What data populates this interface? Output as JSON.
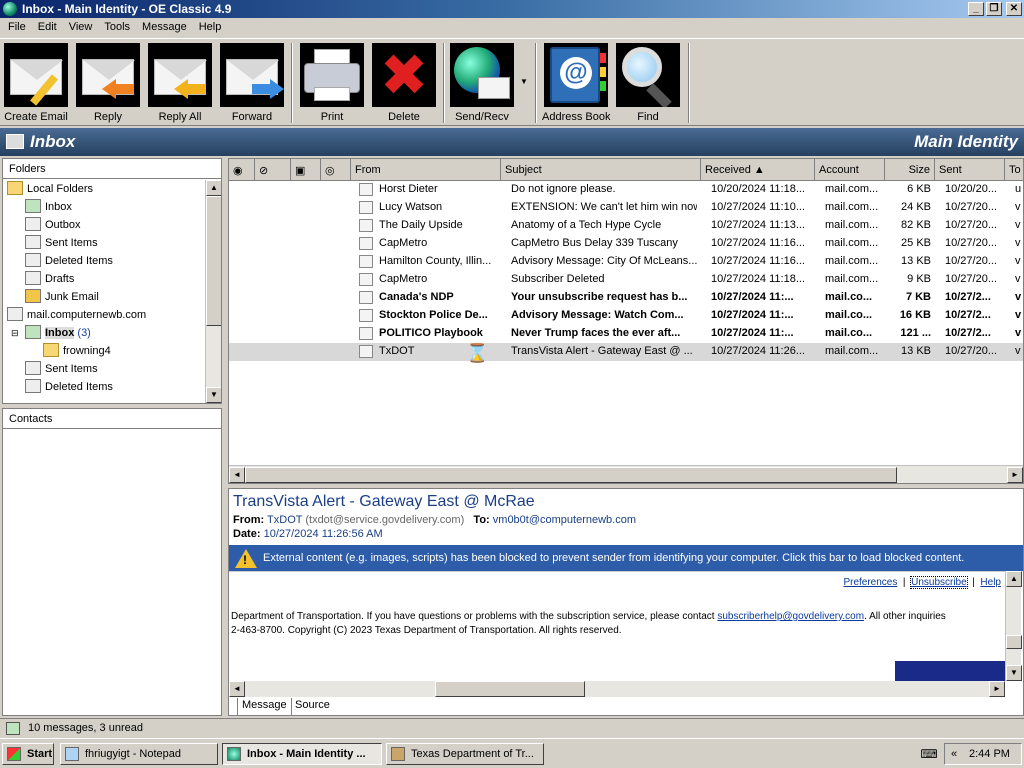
{
  "window": {
    "title": "Inbox - Main Identity - OE Classic 4.9",
    "controls": [
      "_",
      "❐",
      "✕"
    ]
  },
  "menu": [
    "File",
    "Edit",
    "View",
    "Tools",
    "Message",
    "Help"
  ],
  "toolbar": {
    "create_email": "Create Email",
    "reply": "Reply",
    "reply_all": "Reply All",
    "forward": "Forward",
    "print": "Print",
    "delete": "Delete",
    "send_recv": "Send/Recv",
    "address_book": "Address Book",
    "find": "Find"
  },
  "header": {
    "folder": "Inbox",
    "identity": "Main Identity"
  },
  "folders": {
    "title": "Folders",
    "items": [
      {
        "label": "Local Folders"
      },
      {
        "label": "Inbox"
      },
      {
        "label": "Outbox"
      },
      {
        "label": "Sent Items"
      },
      {
        "label": "Deleted Items"
      },
      {
        "label": "Drafts"
      },
      {
        "label": "Junk Email"
      },
      {
        "label": "mail.computernewb.com"
      },
      {
        "label": "Inbox",
        "count": "(3)"
      },
      {
        "label": "frowning4"
      },
      {
        "label": "Sent Items"
      },
      {
        "label": "Deleted Items"
      }
    ]
  },
  "contacts": {
    "title": "Contacts"
  },
  "list": {
    "columns": [
      "From",
      "Subject",
      "Received",
      "Account",
      "Size",
      "Sent",
      "To"
    ],
    "rows": [
      {
        "from": "Horst Dieter",
        "subject": "Do not ignore please.",
        "received": "10/20/2024 11:18...",
        "account": "mail.com...",
        "size": "6 KB",
        "sent": "10/20/20...",
        "to": "u",
        "bold": false
      },
      {
        "from": "Lucy Watson",
        "subject": "EXTENSION: We can't let him win now.",
        "received": "10/27/2024 11:10...",
        "account": "mail.com...",
        "size": "24 KB",
        "sent": "10/27/20...",
        "to": "v",
        "bold": false
      },
      {
        "from": "The Daily Upside",
        "subject": "Anatomy of a Tech Hype Cycle",
        "received": "10/27/2024 11:13...",
        "account": "mail.com...",
        "size": "82 KB",
        "sent": "10/27/20...",
        "to": "v",
        "bold": false
      },
      {
        "from": "CapMetro",
        "subject": "CapMetro Bus Delay 339 Tuscany",
        "received": "10/27/2024 11:16...",
        "account": "mail.com...",
        "size": "25 KB",
        "sent": "10/27/20...",
        "to": "v",
        "bold": false
      },
      {
        "from": "Hamilton County, Illin...",
        "subject": "Advisory Message: City Of McLeans...",
        "received": "10/27/2024 11:16...",
        "account": "mail.com...",
        "size": "13 KB",
        "sent": "10/27/20...",
        "to": "v",
        "bold": false
      },
      {
        "from": "CapMetro",
        "subject": "Subscriber Deleted",
        "received": "10/27/2024 11:18...",
        "account": "mail.com...",
        "size": "9 KB",
        "sent": "10/27/20...",
        "to": "v",
        "bold": false
      },
      {
        "from": "Canada's NDP",
        "subject": "Your unsubscribe request has b...",
        "received": "10/27/2024 11:...",
        "account": "mail.co...",
        "size": "7 KB",
        "sent": "10/27/2...",
        "to": "v",
        "bold": true
      },
      {
        "from": "Stockton Police De...",
        "subject": "Advisory Message: Watch Com...",
        "received": "10/27/2024 11:...",
        "account": "mail.co...",
        "size": "16 KB",
        "sent": "10/27/2...",
        "to": "v",
        "bold": true
      },
      {
        "from": "POLITICO Playbook",
        "subject": "Never Trump faces the ever aft...",
        "received": "10/27/2024 11:...",
        "account": "mail.co...",
        "size": "121 ...",
        "sent": "10/27/2...",
        "to": "v",
        "bold": true
      },
      {
        "from": "TxDOT",
        "subject": "TransVista Alert - Gateway East @ ...",
        "received": "10/27/2024 11:26...",
        "account": "mail.com...",
        "size": "13 KB",
        "sent": "10/27/20...",
        "to": "v",
        "bold": false
      }
    ]
  },
  "preview": {
    "subject": "TransVista Alert - Gateway East @ McRae",
    "from_label": "From:",
    "from_name": "TxDOT",
    "from_email": "(txdot@service.govdelivery.com)",
    "to_label": "To:",
    "to_value": "vm0b0t@computernewb.com",
    "date_label": "Date:",
    "date_value": "10/27/2024 11:26:56 AM",
    "blocked_notice": "External content (e.g. images, scripts) has been blocked to prevent sender from identifying your computer. Click this bar to load blocked content.",
    "link_preferences": "Preferences",
    "link_unsubscribe": "Unsubscribe",
    "link_help": "Help",
    "sep": "|",
    "body_line1_pre": "Department of Transportation. If you have questions or problems with the subscription service, please contact ",
    "body_link": "subscriberhelp@govdelivery.com",
    "body_line1_post": ". All other inquiries",
    "body_line2": "2-463-8700. Copyright (C) 2023 Texas Department of Transportation. All rights reserved.",
    "tabs": [
      "Message",
      "Source"
    ]
  },
  "status": "10 messages, 3 unread",
  "taskbar": {
    "start": "Start",
    "tasks": [
      "fhriugyigt - Notepad",
      "Inbox - Main Identity ...",
      "Texas Department of Tr..."
    ],
    "clock": "2:44 PM",
    "chevron": "«"
  },
  "colors": {
    "title_start": "#0a246a",
    "header_bar": "#25405f",
    "info_bar": "#2d5ca8",
    "delete_red": "#e02020"
  }
}
